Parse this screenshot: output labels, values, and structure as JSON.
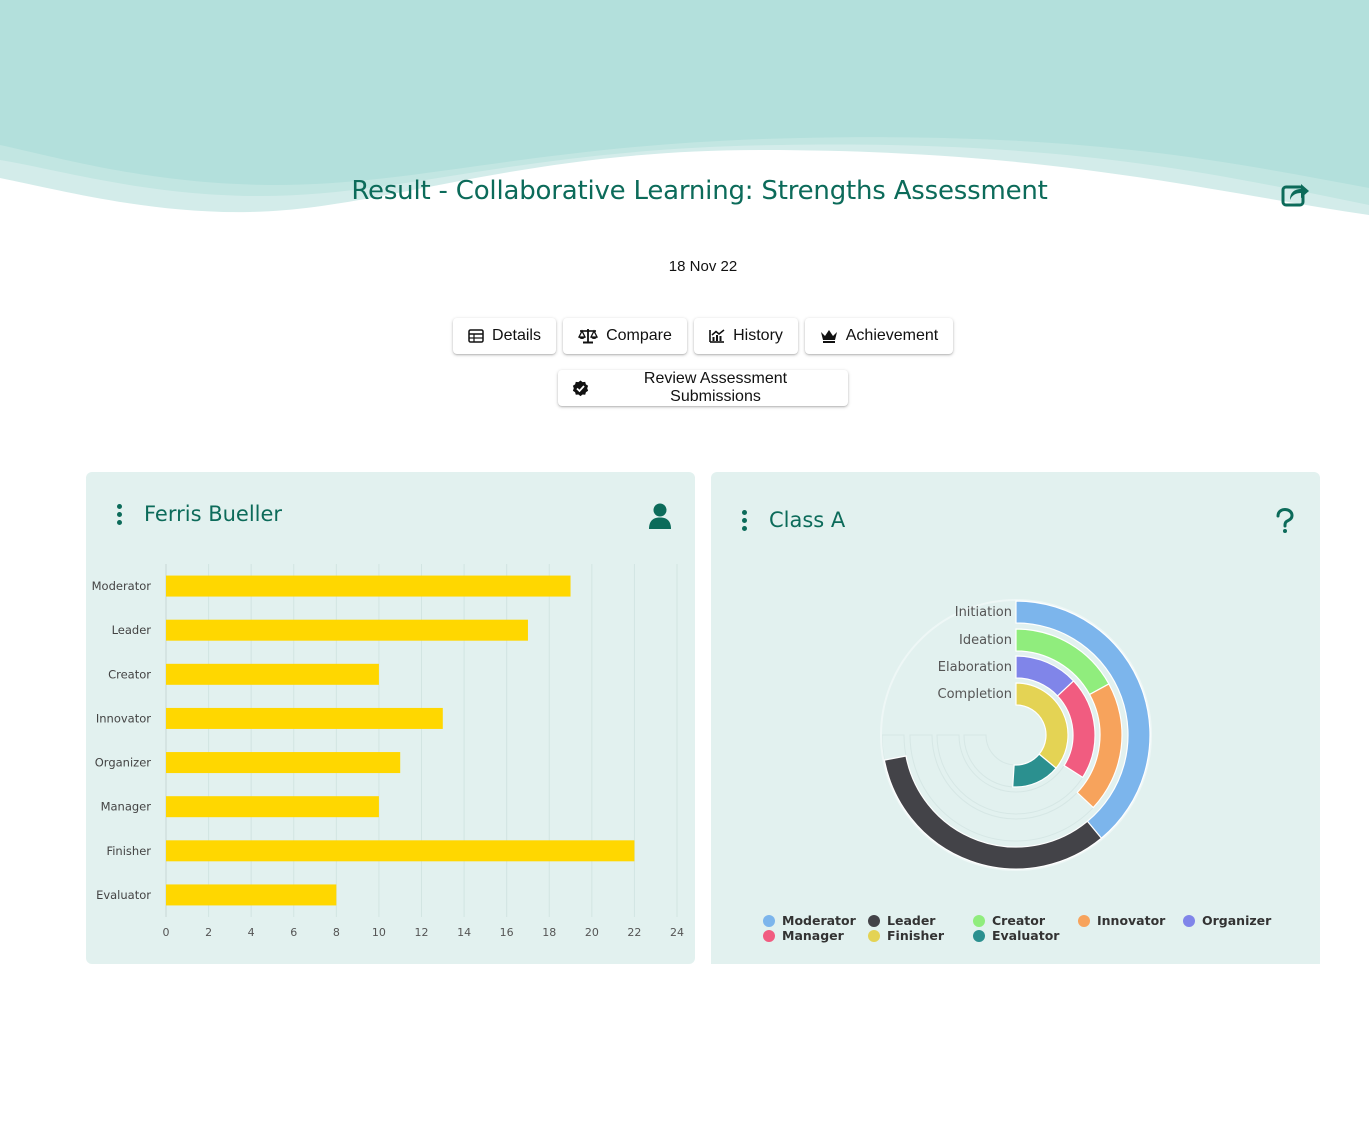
{
  "header": {
    "title": "Result - Collaborative Learning: Strengths Assessment",
    "share_icon": "share-square-icon",
    "date": "18 Nov 22"
  },
  "actions": [
    {
      "label": "Details",
      "icon": "table-icon"
    },
    {
      "label": "Compare",
      "icon": "balance-scale-icon"
    },
    {
      "label": "History",
      "icon": "chart-line-icon"
    },
    {
      "label": "Achievement",
      "icon": "crown-icon"
    },
    {
      "label": "Review Assessment Submissions",
      "icon": "check-badge-icon"
    }
  ],
  "colors": {
    "accent": "#0c6b5a",
    "hero_bg": "#b3e0dc",
    "card_bg": "#e2f1ef",
    "bar": "#ffd700"
  },
  "student_card": {
    "name": "Ferris Bueller",
    "icon": "user-icon",
    "menu_icon": "kebab-menu-icon"
  },
  "class_card": {
    "name": "Class A",
    "icon": "question-mark-icon",
    "menu_icon": "kebab-menu-icon"
  },
  "chart_data": [
    {
      "type": "bar",
      "orientation": "horizontal",
      "categories": [
        "Moderator",
        "Leader",
        "Creator",
        "Innovator",
        "Organizer",
        "Manager",
        "Finisher",
        "Evaluator"
      ],
      "values": [
        19,
        17,
        10,
        13,
        11,
        10,
        22,
        8
      ],
      "xlim": [
        0,
        24
      ],
      "x_ticks": [
        "0",
        "2",
        "4",
        "6",
        "8",
        "10",
        "12",
        "14",
        "16",
        "18",
        "20",
        "22",
        "24"
      ],
      "grid": true,
      "color": "#ffd700"
    },
    {
      "type": "radial-bar",
      "rings": [
        "Initiation",
        "Ideation",
        "Elaboration",
        "Completion"
      ],
      "legend_position": "bottom",
      "series": [
        {
          "name": "Moderator",
          "color": "#7cb5ec"
        },
        {
          "name": "Leader",
          "color": "#434348"
        },
        {
          "name": "Creator",
          "color": "#90ed7d"
        },
        {
          "name": "Innovator",
          "color": "#f7a35c"
        },
        {
          "name": "Organizer",
          "color": "#8085e9"
        },
        {
          "name": "Manager",
          "color": "#f15c80"
        },
        {
          "name": "Finisher",
          "color": "#e4d354"
        },
        {
          "name": "Evaluator",
          "color": "#2b908f"
        }
      ],
      "ring_segments": [
        [
          {
            "series": "Moderator",
            "value": 0.39
          },
          {
            "series": "Leader",
            "value": 0.33
          }
        ],
        [
          {
            "series": "Creator",
            "value": 0.17
          },
          {
            "series": "Innovator",
            "value": 0.2
          }
        ],
        [
          {
            "series": "Organizer",
            "value": 0.13
          },
          {
            "series": "Manager",
            "value": 0.21
          }
        ],
        [
          {
            "series": "Finisher",
            "value": 0.36
          },
          {
            "series": "Evaluator",
            "value": 0.15
          }
        ]
      ]
    }
  ]
}
